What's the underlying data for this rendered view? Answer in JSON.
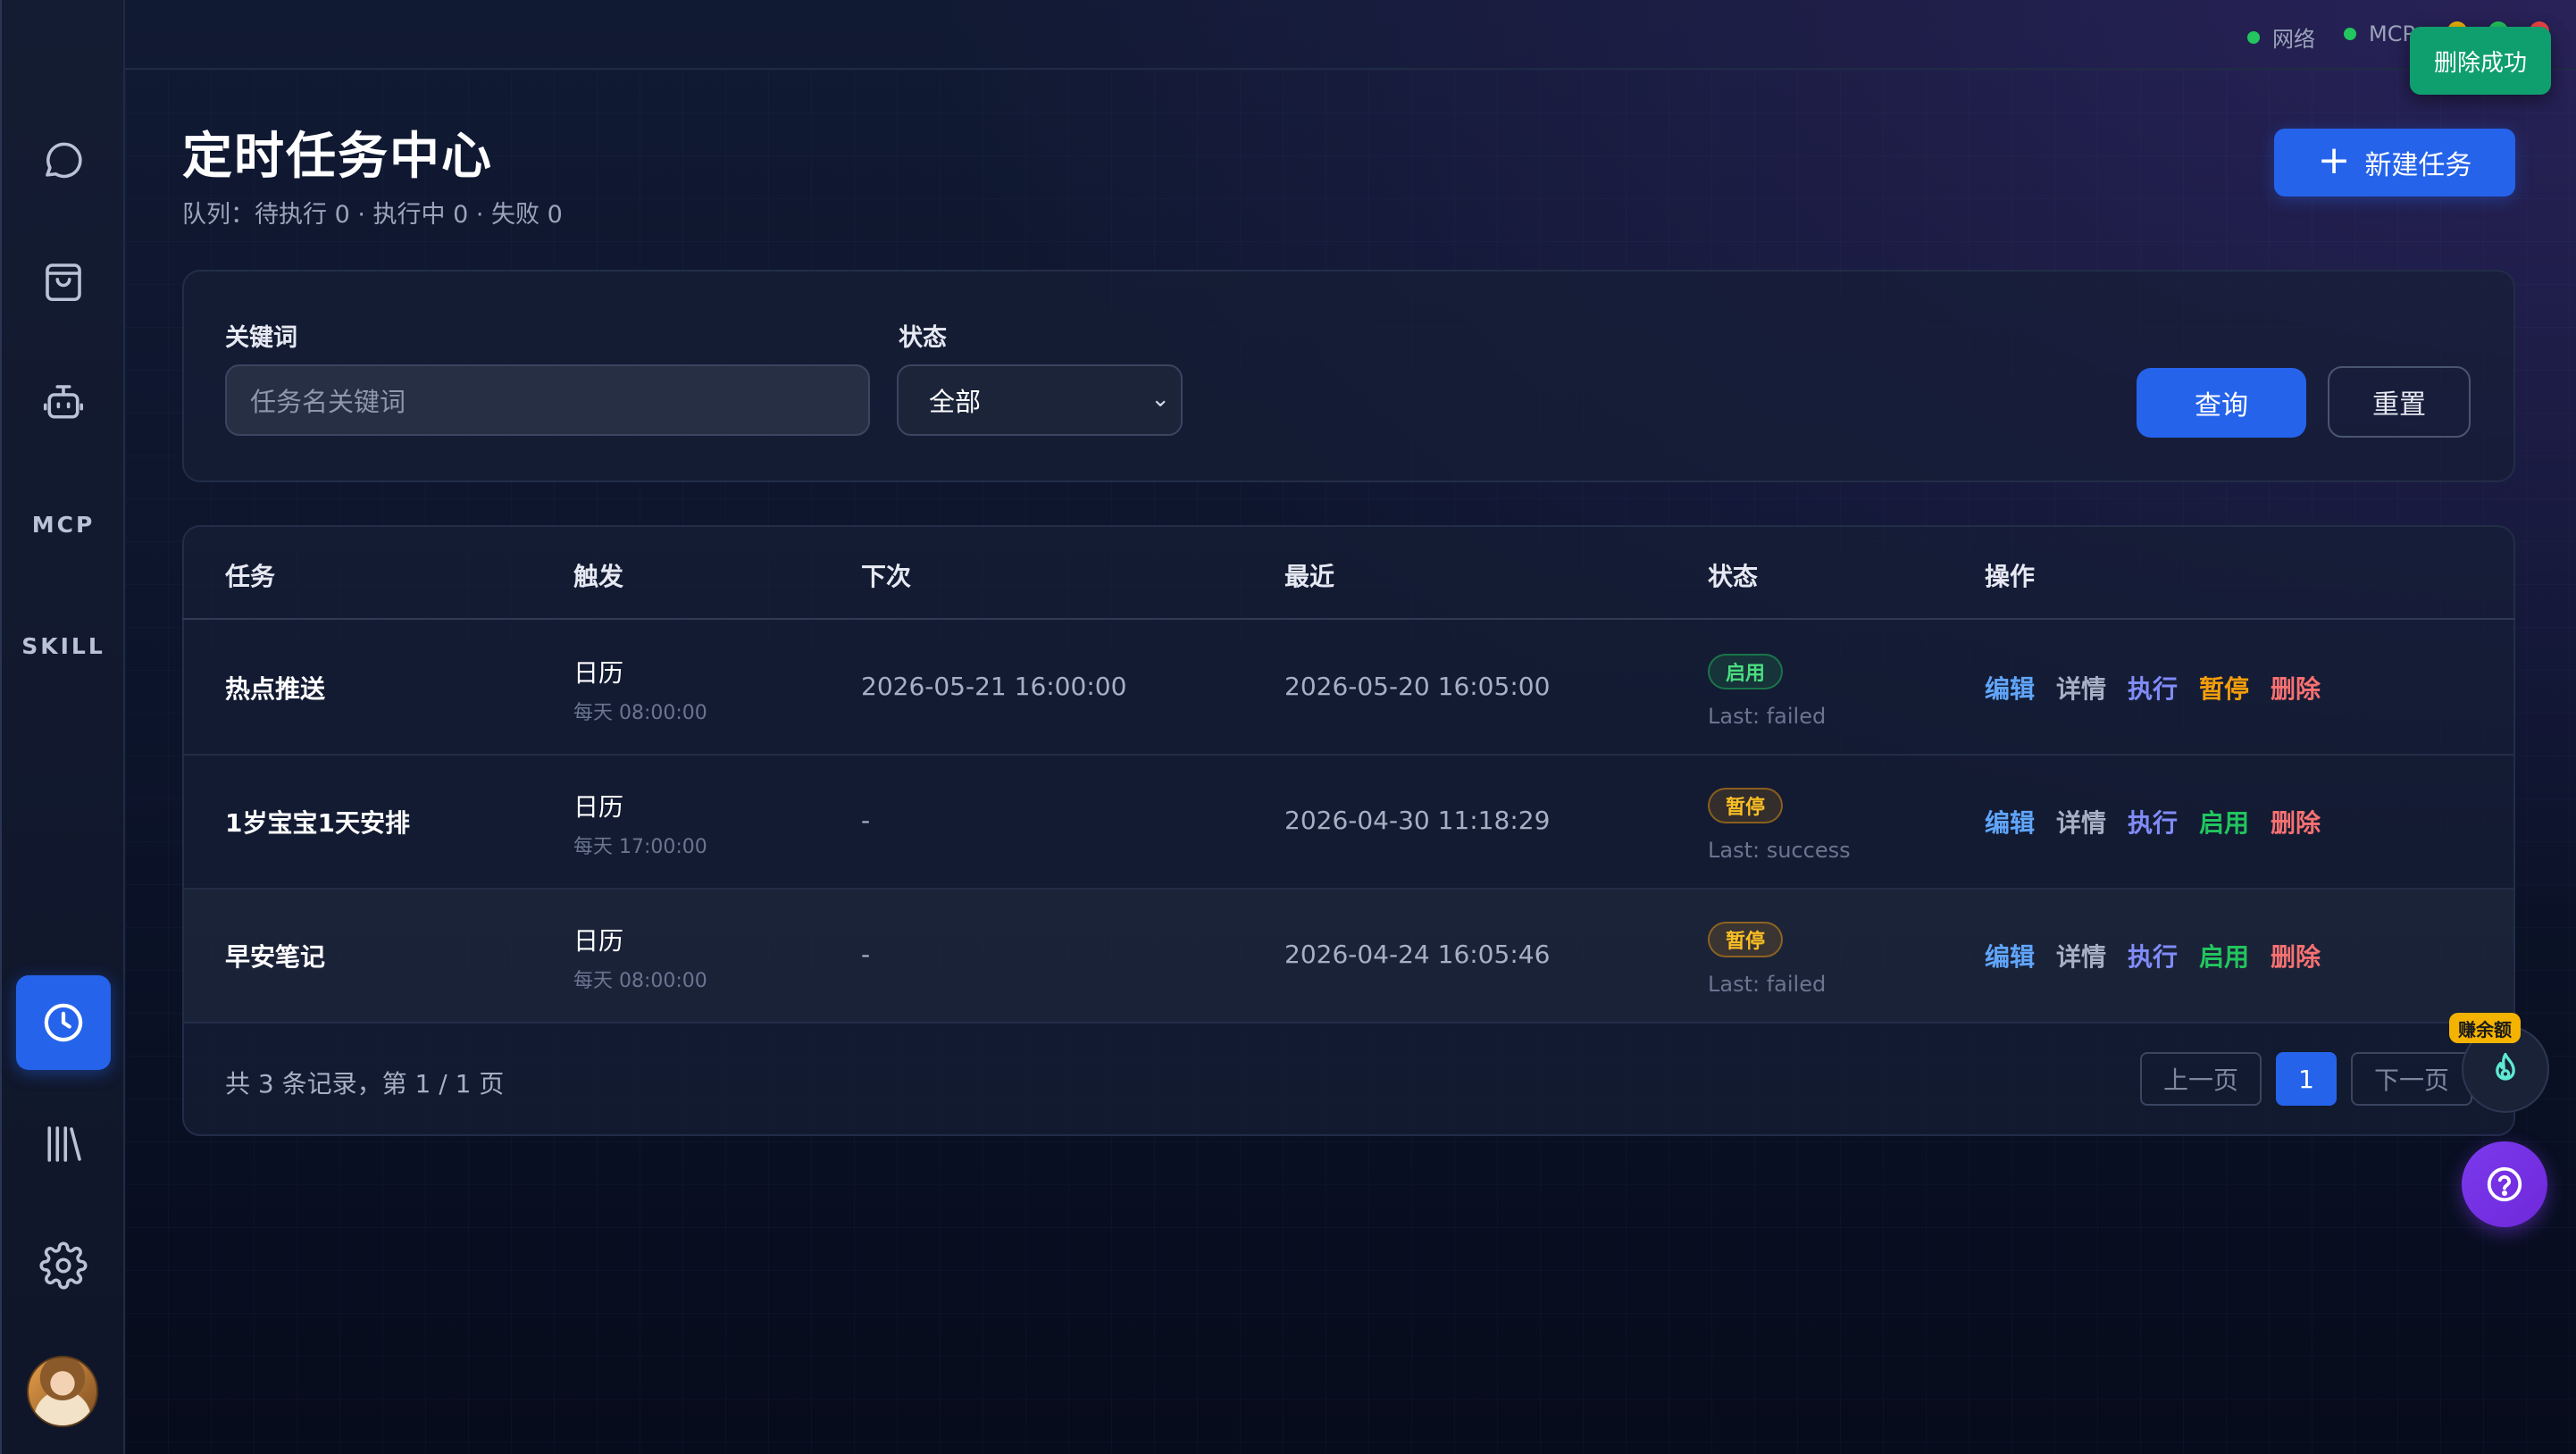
{
  "sidebar": {
    "mcp_label": "MCP",
    "skill_label": "SKILL",
    "items": [
      {
        "icon": "chat-icon"
      },
      {
        "icon": "shopping-bag-icon"
      },
      {
        "icon": "robot-icon"
      },
      {
        "icon": "mcp-text"
      },
      {
        "icon": "skill-text"
      },
      {
        "icon": "clock-icon",
        "active": true
      },
      {
        "icon": "library-icon"
      },
      {
        "icon": "settings-icon"
      },
      {
        "icon": "user-avatar"
      }
    ]
  },
  "topbar": {
    "network_label": "网络",
    "mcp_label": "MCP",
    "status_color": "#22c55e"
  },
  "toast": {
    "message": "删除成功"
  },
  "header": {
    "title": "定时任务中心",
    "queue_info": "队列：待执行 0 · 执行中 0 · 失败 0",
    "new_task_label": "新建任务"
  },
  "filter": {
    "keyword_label": "关键词",
    "keyword_placeholder": "任务名关键词",
    "status_label": "状态",
    "status_value": "全部",
    "query_label": "查询",
    "reset_label": "重置"
  },
  "table": {
    "columns": [
      "任务",
      "触发",
      "下次",
      "最近",
      "状态",
      "操作"
    ],
    "rows": [
      {
        "task": "热点推送",
        "trigger": "日历",
        "trigger_detail": "每天 08:00:00",
        "next": "2026-05-21 16:00:00",
        "last": "2026-05-20 16:05:00",
        "status": "启用",
        "last_result": "Last: failed",
        "actions": [
          "编辑",
          "详情",
          "执行",
          "暂停",
          "删除"
        ]
      },
      {
        "task": "1岁宝宝1天安排",
        "trigger": "日历",
        "trigger_detail": "每天 17:00:00",
        "next": "-",
        "last": "2026-04-30 11:18:29",
        "status": "暂停",
        "last_result": "Last: success",
        "actions": [
          "编辑",
          "详情",
          "执行",
          "启用",
          "删除"
        ]
      },
      {
        "task": "早安笔记",
        "trigger": "日历",
        "trigger_detail": "每天 08:00:00",
        "next": "-",
        "last": "2026-04-24 16:05:46",
        "status": "暂停",
        "last_result": "Last: failed",
        "actions": [
          "编辑",
          "详情",
          "执行",
          "启用",
          "删除"
        ]
      }
    ]
  },
  "pagination": {
    "summary": "共 3 条记录，第 1 / 1 页",
    "prev_label": "上一页",
    "current_page": "1",
    "next_label": "下一页"
  },
  "floating": {
    "balance_badge": "赚余额"
  },
  "colors": {
    "accent": "#2563eb",
    "enabled": "#22c55e",
    "paused": "#f59e0b",
    "delete": "#f87171",
    "edit": "#60a5fa",
    "run": "#818cf8"
  }
}
